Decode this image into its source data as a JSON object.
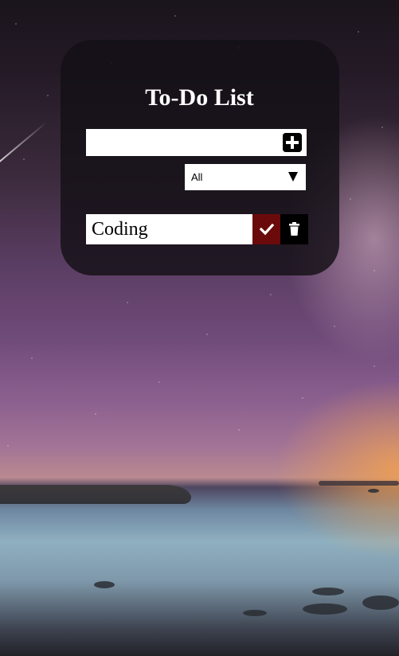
{
  "app": {
    "title": "To-Do List"
  },
  "input": {
    "value": "",
    "placeholder": ""
  },
  "add_button": {
    "icon": "plus-square-icon"
  },
  "filter": {
    "selected": "All",
    "icon": "caret-down-icon"
  },
  "todos": [
    {
      "text": "Coding",
      "complete_icon": "check-icon",
      "delete_icon": "trash-icon"
    }
  ],
  "colors": {
    "complete_button": "#6b0a0a",
    "trash_button": "#000000",
    "card_background": "#141016"
  }
}
